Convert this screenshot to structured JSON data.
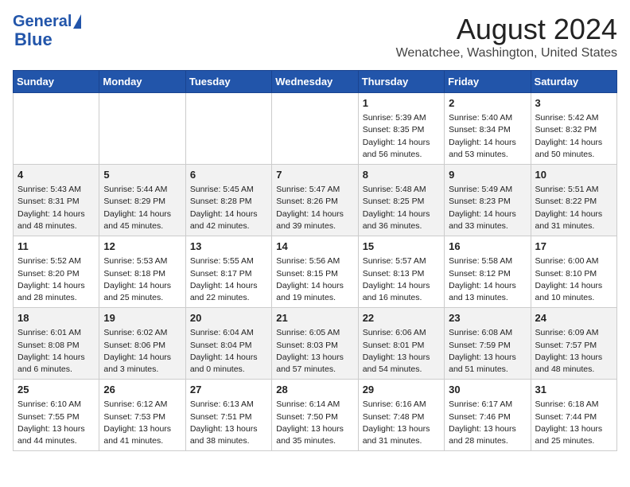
{
  "header": {
    "logo_general": "General",
    "logo_blue": "Blue",
    "main_title": "August 2024",
    "subtitle": "Wenatchee, Washington, United States"
  },
  "calendar": {
    "days_of_week": [
      "Sunday",
      "Monday",
      "Tuesday",
      "Wednesday",
      "Thursday",
      "Friday",
      "Saturday"
    ],
    "weeks": [
      [
        {
          "day": "",
          "content": ""
        },
        {
          "day": "",
          "content": ""
        },
        {
          "day": "",
          "content": ""
        },
        {
          "day": "",
          "content": ""
        },
        {
          "day": "1",
          "content": "Sunrise: 5:39 AM\nSunset: 8:35 PM\nDaylight: 14 hours and 56 minutes."
        },
        {
          "day": "2",
          "content": "Sunrise: 5:40 AM\nSunset: 8:34 PM\nDaylight: 14 hours and 53 minutes."
        },
        {
          "day": "3",
          "content": "Sunrise: 5:42 AM\nSunset: 8:32 PM\nDaylight: 14 hours and 50 minutes."
        }
      ],
      [
        {
          "day": "4",
          "content": "Sunrise: 5:43 AM\nSunset: 8:31 PM\nDaylight: 14 hours and 48 minutes."
        },
        {
          "day": "5",
          "content": "Sunrise: 5:44 AM\nSunset: 8:29 PM\nDaylight: 14 hours and 45 minutes."
        },
        {
          "day": "6",
          "content": "Sunrise: 5:45 AM\nSunset: 8:28 PM\nDaylight: 14 hours and 42 minutes."
        },
        {
          "day": "7",
          "content": "Sunrise: 5:47 AM\nSunset: 8:26 PM\nDaylight: 14 hours and 39 minutes."
        },
        {
          "day": "8",
          "content": "Sunrise: 5:48 AM\nSunset: 8:25 PM\nDaylight: 14 hours and 36 minutes."
        },
        {
          "day": "9",
          "content": "Sunrise: 5:49 AM\nSunset: 8:23 PM\nDaylight: 14 hours and 33 minutes."
        },
        {
          "day": "10",
          "content": "Sunrise: 5:51 AM\nSunset: 8:22 PM\nDaylight: 14 hours and 31 minutes."
        }
      ],
      [
        {
          "day": "11",
          "content": "Sunrise: 5:52 AM\nSunset: 8:20 PM\nDaylight: 14 hours and 28 minutes."
        },
        {
          "day": "12",
          "content": "Sunrise: 5:53 AM\nSunset: 8:18 PM\nDaylight: 14 hours and 25 minutes."
        },
        {
          "day": "13",
          "content": "Sunrise: 5:55 AM\nSunset: 8:17 PM\nDaylight: 14 hours and 22 minutes."
        },
        {
          "day": "14",
          "content": "Sunrise: 5:56 AM\nSunset: 8:15 PM\nDaylight: 14 hours and 19 minutes."
        },
        {
          "day": "15",
          "content": "Sunrise: 5:57 AM\nSunset: 8:13 PM\nDaylight: 14 hours and 16 minutes."
        },
        {
          "day": "16",
          "content": "Sunrise: 5:58 AM\nSunset: 8:12 PM\nDaylight: 14 hours and 13 minutes."
        },
        {
          "day": "17",
          "content": "Sunrise: 6:00 AM\nSunset: 8:10 PM\nDaylight: 14 hours and 10 minutes."
        }
      ],
      [
        {
          "day": "18",
          "content": "Sunrise: 6:01 AM\nSunset: 8:08 PM\nDaylight: 14 hours and 6 minutes."
        },
        {
          "day": "19",
          "content": "Sunrise: 6:02 AM\nSunset: 8:06 PM\nDaylight: 14 hours and 3 minutes."
        },
        {
          "day": "20",
          "content": "Sunrise: 6:04 AM\nSunset: 8:04 PM\nDaylight: 14 hours and 0 minutes."
        },
        {
          "day": "21",
          "content": "Sunrise: 6:05 AM\nSunset: 8:03 PM\nDaylight: 13 hours and 57 minutes."
        },
        {
          "day": "22",
          "content": "Sunrise: 6:06 AM\nSunset: 8:01 PM\nDaylight: 13 hours and 54 minutes."
        },
        {
          "day": "23",
          "content": "Sunrise: 6:08 AM\nSunset: 7:59 PM\nDaylight: 13 hours and 51 minutes."
        },
        {
          "day": "24",
          "content": "Sunrise: 6:09 AM\nSunset: 7:57 PM\nDaylight: 13 hours and 48 minutes."
        }
      ],
      [
        {
          "day": "25",
          "content": "Sunrise: 6:10 AM\nSunset: 7:55 PM\nDaylight: 13 hours and 44 minutes."
        },
        {
          "day": "26",
          "content": "Sunrise: 6:12 AM\nSunset: 7:53 PM\nDaylight: 13 hours and 41 minutes."
        },
        {
          "day": "27",
          "content": "Sunrise: 6:13 AM\nSunset: 7:51 PM\nDaylight: 13 hours and 38 minutes."
        },
        {
          "day": "28",
          "content": "Sunrise: 6:14 AM\nSunset: 7:50 PM\nDaylight: 13 hours and 35 minutes."
        },
        {
          "day": "29",
          "content": "Sunrise: 6:16 AM\nSunset: 7:48 PM\nDaylight: 13 hours and 31 minutes."
        },
        {
          "day": "30",
          "content": "Sunrise: 6:17 AM\nSunset: 7:46 PM\nDaylight: 13 hours and 28 minutes."
        },
        {
          "day": "31",
          "content": "Sunrise: 6:18 AM\nSunset: 7:44 PM\nDaylight: 13 hours and 25 minutes."
        }
      ]
    ]
  }
}
